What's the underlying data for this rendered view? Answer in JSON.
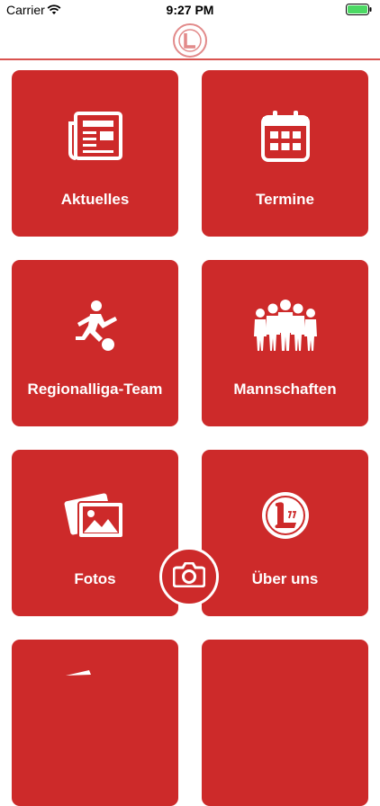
{
  "status_bar": {
    "carrier": "Carrier",
    "time": "9:27 PM"
  },
  "colors": {
    "accent": "#cd2a2a",
    "nav_border": "#d9534f"
  },
  "tiles": [
    {
      "label": "Aktuelles",
      "icon": "newspaper-icon"
    },
    {
      "label": "Termine",
      "icon": "calendar-icon"
    },
    {
      "label": "Regionalliga-Team",
      "icon": "football-player-icon"
    },
    {
      "label": "Mannschaften",
      "icon": "team-icon"
    },
    {
      "label": "Fotos",
      "icon": "photos-icon"
    },
    {
      "label": "Über uns",
      "icon": "club-logo-icon"
    }
  ],
  "camera_button": {
    "icon": "camera-icon"
  }
}
